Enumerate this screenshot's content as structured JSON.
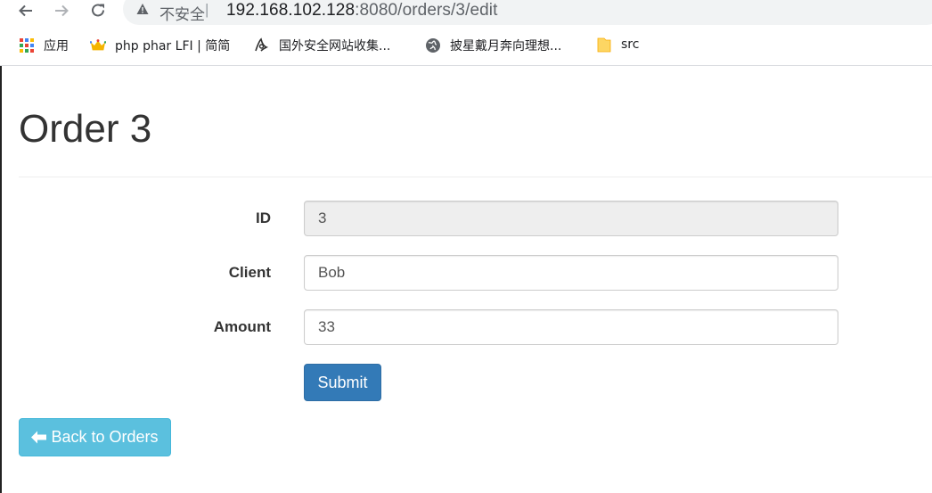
{
  "browser": {
    "back_icon": "arrow-left-icon",
    "forward_icon": "arrow-right-icon",
    "reload_icon": "reload-icon",
    "security_label": "不安全",
    "security_separator": "|",
    "url_host": "192.168.102.128",
    "url_rest": ":8080/orders/3/edit"
  },
  "bookmarks": [
    {
      "icon": "apps-grid-icon",
      "label": "应用"
    },
    {
      "icon": "crown-icon",
      "label": "php phar LFI | 简简"
    },
    {
      "icon": "site-logo-icon",
      "label": "国外安全网站收集..."
    },
    {
      "icon": "globe-icon",
      "label": "披星戴月奔向理想..."
    },
    {
      "icon": "folder-icon",
      "label": "src"
    }
  ],
  "page": {
    "title": "Order 3",
    "form": {
      "id": {
        "label": "ID",
        "value": "3"
      },
      "client": {
        "label": "Client",
        "value": "Bob"
      },
      "amount": {
        "label": "Amount",
        "value": "33"
      },
      "submit_label": "Submit"
    },
    "back_label": "Back to Orders"
  },
  "colors": {
    "primary": "#337ab7",
    "info": "#5bc0de",
    "readonly_bg": "#eeeeee"
  }
}
